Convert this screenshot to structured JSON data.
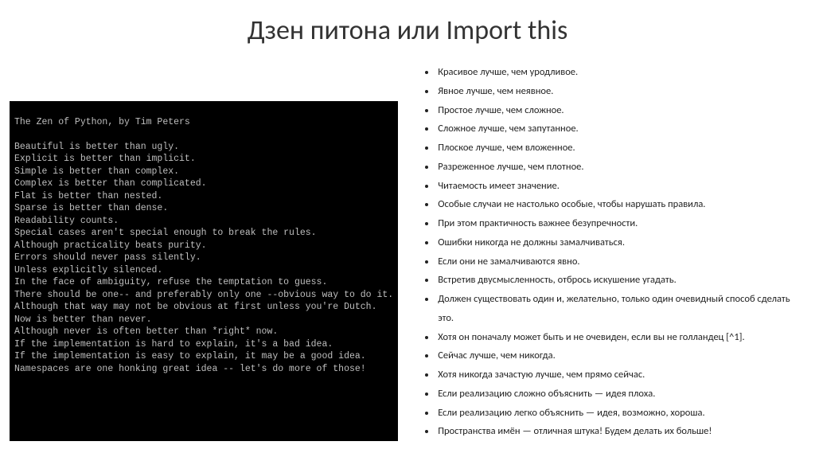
{
  "title": "Дзен питона или Import  this",
  "terminal": {
    "heading": "The Zen of Python, by Tim Peters",
    "lines": [
      "Beautiful is better than ugly.",
      "Explicit is better than implicit.",
      "Simple is better than complex.",
      "Complex is better than complicated.",
      "Flat is better than nested.",
      "Sparse is better than dense.",
      "Readability counts.",
      "Special cases aren't special enough to break the rules.",
      "Although practicality beats purity.",
      "Errors should never pass silently.",
      "Unless explicitly silenced.",
      "In the face of ambiguity, refuse the temptation to guess.",
      "There should be one-- and preferably only one --obvious way to do it.",
      "Although that way may not be obvious at first unless you're Dutch.",
      "Now is better than never.",
      "Although never is often better than *right* now.",
      "If the implementation is hard to explain, it's a bad idea.",
      "If the implementation is easy to explain, it may be a good idea.",
      "Namespaces are one honking great idea -- let's do more of those!"
    ]
  },
  "russian_list": [
    "Красивое лучше, чем уродливое.",
    "Явное лучше, чем неявное.",
    "Простое лучше, чем сложное.",
    "Сложное лучше, чем запутанное.",
    "Плоское лучше, чем вложенное.",
    "Разреженное лучше, чем плотное.",
    "Читаемость имеет значение.",
    "Особые случаи не настолько особые, чтобы нарушать правила.",
    "При этом практичность важнее безупречности.",
    "Ошибки никогда не должны замалчиваться.",
    "Если они не замалчиваются явно.",
    "Встретив двусмысленность, отбрось искушение угадать.",
    "Должен существовать один и, желательно, только один очевидный способ сделать это.",
    "Хотя он поначалу может быть и не очевиден, если вы не голландец [^1].",
    "Сейчас лучше, чем никогда.",
    "Хотя никогда зачастую лучше, чем прямо сейчас.",
    "Если реализацию сложно объяснить — идея плоха.",
    "Если реализацию легко объяснить — идея, возможно, хороша.",
    "Пространства имён — отличная штука! Будем делать их больше!"
  ]
}
